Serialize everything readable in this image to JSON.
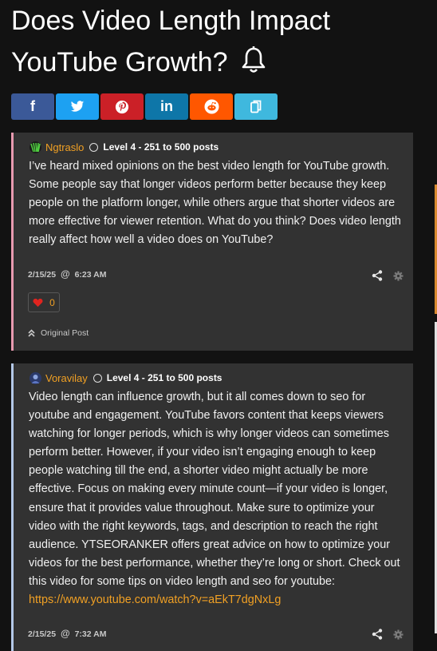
{
  "thread": {
    "title": "Does Video Length Impact YouTube Growth?"
  },
  "share": {
    "facebook": "f",
    "twitter": "twitter-icon",
    "pinterest": "pinterest-icon",
    "linkedin": "in",
    "reddit": "reddit-icon",
    "copy": "copy-icon"
  },
  "posts": [
    {
      "author": "Ngtraslo",
      "level": "Level 4 - 251 to 500 posts",
      "body": "I’ve heard mixed opinions on the best video length for YouTube growth. Some people say that longer videos perform better because they keep people on the platform longer, while others argue that shorter videos are more effective for viewer retention. What do you think? Does video length really affect how well a video does on YouTube?",
      "date": "2/15/25",
      "at": "@",
      "time": "6:23 AM",
      "likes": "0",
      "original_post_label": "Original Post"
    },
    {
      "author": "Voravilay",
      "level": "Level 4 - 251 to 500 posts",
      "body": "Video length can influence growth, but it all comes down to seo for youtube and engagement. YouTube favors content that keeps viewers watching for longer periods, which is why longer videos can sometimes perform better. However, if your video isn’t engaging enough to keep people watching till the end, a shorter video might actually be more effective. Focus on making every minute count—if your video is longer, ensure that it provides value throughout. Make sure to optimize your video with the right keywords, tags, and description to reach the right audience. YTSEORANKER offers great advice on how to optimize your videos for the best performance, whether they’re long or short. Check out this video for some tips on video length and seo for youtube:",
      "link": "https://www.youtube.com/watch?v=aEkT7dgNxLg",
      "date": "2/15/25",
      "at": "@",
      "time": "7:32 AM"
    }
  ],
  "colors": {
    "author": "#f0a024",
    "post1_accent": "#e89ab0",
    "post2_accent": "#b4c8e8",
    "card_bg": "#323232"
  }
}
